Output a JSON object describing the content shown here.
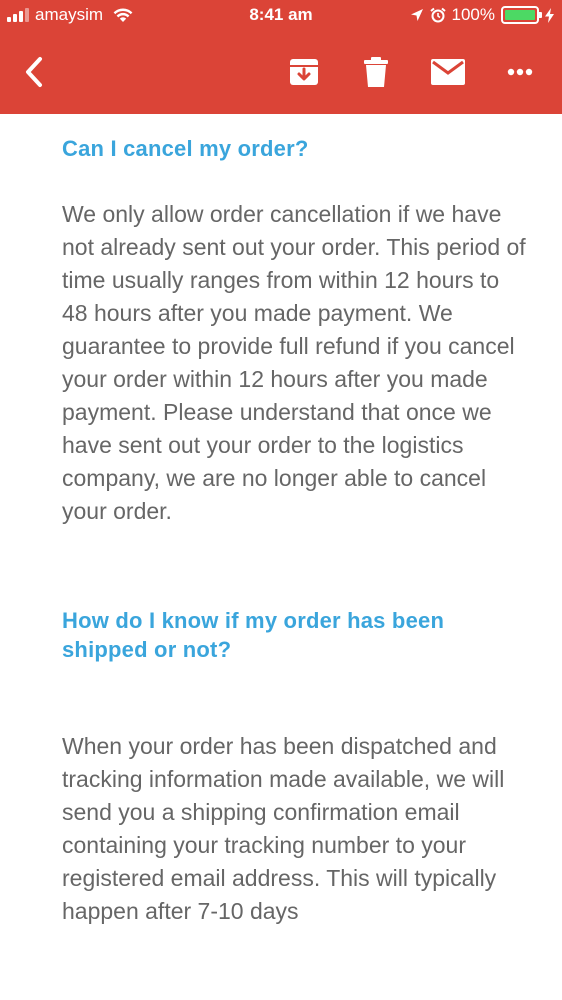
{
  "status_bar": {
    "carrier": "amaysim",
    "time": "8:41 am",
    "battery_percent": "100%",
    "battery_level": 1.0,
    "icons": [
      "signal-icon",
      "wifi-icon",
      "location-icon",
      "alarm-icon",
      "battery-icon",
      "charging-icon"
    ]
  },
  "toolbar": {
    "icons": [
      "back-arrow-icon",
      "archive-icon",
      "trash-icon",
      "mail-icon",
      "more-icon"
    ],
    "color": "#db4437"
  },
  "faq": [
    {
      "question": "Can I cancel my order?",
      "answer": "We only allow order cancellation if we have not already sent out your order. This period of time usually ranges from within 12 hours to 48 hours after you made payment. We guarantee to provide full refund if you cancel your order within 12 hours after you made payment. Please understand that once we have sent out your order to the logistics company, we are no longer able to cancel your order."
    },
    {
      "question": "How do I know if my order has been shipped or not?",
      "answer": "When your order has been dispatched and tracking information made available, we will send you a shipping confirmation email containing your tracking number to your registered email address. This will typically happen after 7-10 days"
    }
  ],
  "colors": {
    "heading": "#3aa5dc",
    "body_text": "#666666",
    "background": "#ffffff"
  }
}
